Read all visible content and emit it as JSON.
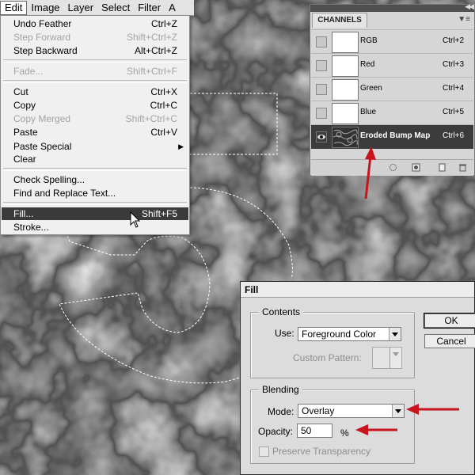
{
  "menubar": {
    "items": [
      "Edit",
      "Image",
      "Layer",
      "Select",
      "Filter",
      "A"
    ]
  },
  "edit_menu": {
    "items": [
      {
        "label": "Undo Feather",
        "shortcut": "Ctrl+Z",
        "disabled": false
      },
      {
        "label": "Step Forward",
        "shortcut": "Shift+Ctrl+Z",
        "disabled": true
      },
      {
        "label": "Step Backward",
        "shortcut": "Alt+Ctrl+Z",
        "disabled": false
      },
      {
        "label": "Fade...",
        "shortcut": "Shift+Ctrl+F",
        "disabled": true
      },
      {
        "label": "Cut",
        "shortcut": "Ctrl+X",
        "disabled": false
      },
      {
        "label": "Copy",
        "shortcut": "Ctrl+C",
        "disabled": false
      },
      {
        "label": "Copy Merged",
        "shortcut": "Shift+Ctrl+C",
        "disabled": true
      },
      {
        "label": "Paste",
        "shortcut": "Ctrl+V",
        "disabled": false
      },
      {
        "label": "Paste Special",
        "shortcut": "",
        "disabled": false
      },
      {
        "label": "Clear",
        "shortcut": "",
        "disabled": false
      },
      {
        "label": "Check Spelling...",
        "shortcut": "",
        "disabled": false
      },
      {
        "label": "Find and Replace Text...",
        "shortcut": "",
        "disabled": false
      },
      {
        "label": "Fill...",
        "shortcut": "Shift+F5",
        "disabled": false
      },
      {
        "label": "Stroke...",
        "shortcut": "",
        "disabled": false
      }
    ]
  },
  "channels": {
    "tab": "CHANNELS",
    "rows": [
      {
        "name": "RGB",
        "shortcut": "Ctrl+2"
      },
      {
        "name": "Red",
        "shortcut": "Ctrl+3"
      },
      {
        "name": "Green",
        "shortcut": "Ctrl+4"
      },
      {
        "name": "Blue",
        "shortcut": "Ctrl+5"
      },
      {
        "name": "Eroded Bump Map",
        "shortcut": "Ctrl+6"
      }
    ]
  },
  "fill_dialog": {
    "title": "Fill",
    "contents_legend": "Contents",
    "use_label": "Use:",
    "use_value": "Foreground Color",
    "custom_pattern_label": "Custom Pattern:",
    "blending_legend": "Blending",
    "mode_label": "Mode:",
    "mode_value": "Overlay",
    "opacity_label": "Opacity:",
    "opacity_value": "50",
    "opacity_unit": "%",
    "preserve_label": "Preserve Transparency",
    "ok_label": "OK",
    "cancel_label": "Cancel"
  },
  "colors": {
    "highlight": "#3a3a3a",
    "arrow": "#c8141c"
  }
}
